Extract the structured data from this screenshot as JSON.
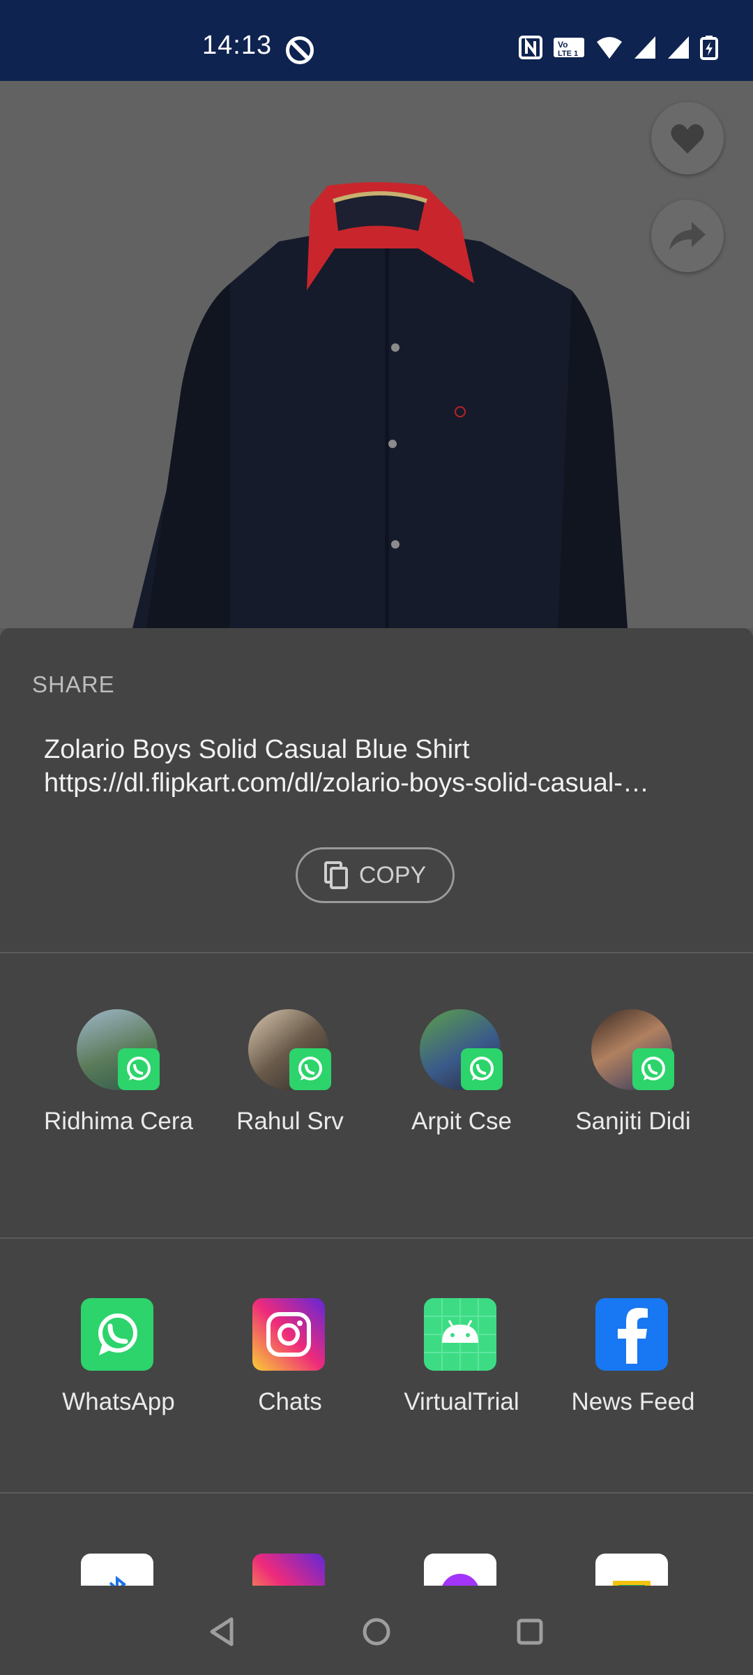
{
  "status_bar": {
    "time": "14:13"
  },
  "share_sheet": {
    "title": "SHARE",
    "text_line1": "Zolario Boys Solid Casual Blue Shirt",
    "text_line2": "https://dl.flipkart.com/dl/zolario-boys-solid-casual-…",
    "copy_label": "COPY"
  },
  "contacts": [
    {
      "name": "Ridhima Cera"
    },
    {
      "name": "Rahul Srv"
    },
    {
      "name": "Arpit Cse"
    },
    {
      "name": "Sanjiti Didi"
    }
  ],
  "apps": [
    {
      "name": "WhatsApp",
      "icon": "whatsapp-icon",
      "color": "#2cd46b"
    },
    {
      "name": "Chats",
      "icon": "instagram-icon",
      "color": "#d6249f"
    },
    {
      "name": "VirtualTrial",
      "icon": "android-icon",
      "color": "#3ddc84"
    },
    {
      "name": "News Feed",
      "icon": "facebook-icon",
      "color": "#1877f2"
    }
  ],
  "colors": {
    "status_bar": "#0e2350",
    "sheet": "#444444",
    "whatsapp": "#2cd46b"
  }
}
